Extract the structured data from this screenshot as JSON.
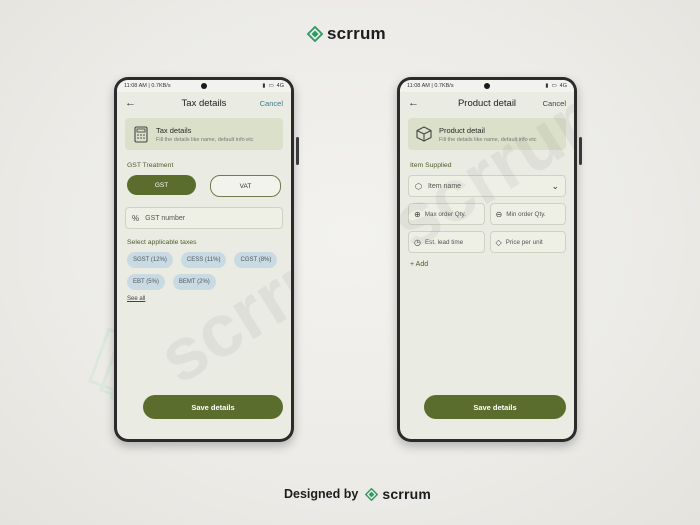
{
  "brand": {
    "name": "scrrum",
    "designed_by": "Designed by"
  },
  "colors": {
    "accent": "#5b6d2d",
    "card": "#dbe0ca",
    "chip": "#c9dae2",
    "link": "#3d7d8b"
  },
  "watermark": "scrrum",
  "status_bar": {
    "time": "11:08 AM",
    "speed": "0.7KB/s",
    "network": "4G",
    "time_label": "11:08 AM | 0.7KB/s"
  },
  "left": {
    "title": "Tax details",
    "cancel": "Cancel",
    "card": {
      "title": "Tax details",
      "subtitle": "Fill the details like name, default info etc",
      "icon": "calculator-icon"
    },
    "section1": "GST Treatment",
    "toggle": {
      "options": [
        "GST",
        "VAT"
      ],
      "selected": "GST"
    },
    "gst_field": {
      "placeholder": "GST number",
      "icon": "percent-icon"
    },
    "section2": "Select applicable taxes",
    "taxes": [
      "SGST (12%)",
      "CESS (11%)",
      "CGST (8%)",
      "EBT (5%)",
      "BEMT (2%)"
    ],
    "see_all": "See all",
    "save": "Save details"
  },
  "right": {
    "title": "Product detail",
    "cancel": "Cancel",
    "card": {
      "title": "Product detail",
      "subtitle": "Fill the details like name, default info etc",
      "icon": "box-icon"
    },
    "section1": "Item Supplied",
    "item_name": "Item name",
    "fields": [
      {
        "label": "Max order Qty.",
        "icon": "plus-circle-icon"
      },
      {
        "label": "Min order Qty.",
        "icon": "minus-circle-icon"
      },
      {
        "label": "Est. lead time",
        "icon": "clock-icon"
      },
      {
        "label": "Price per unit",
        "icon": "tag-icon"
      }
    ],
    "add": "+ Add",
    "save": "Save details"
  }
}
